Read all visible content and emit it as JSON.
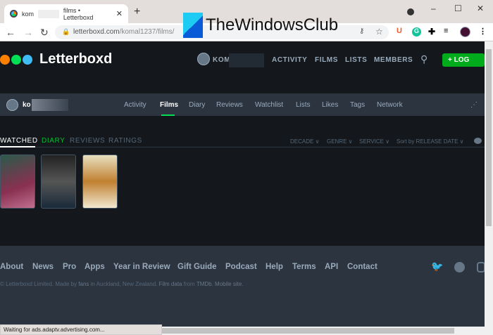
{
  "browser": {
    "tab_title_prefix": "kom",
    "tab_title_suffix": "films • Letterboxd",
    "new_tab": "+",
    "url_host": "letterboxd.com",
    "url_path": "/komal1237/films/",
    "watermark": "TheWindowsClub",
    "status": "Waiting for ads.adaptv.advertising.com..."
  },
  "header": {
    "brand": "Letterboxd",
    "user": "KOM",
    "nav": [
      "ACTIVITY",
      "FILMS",
      "LISTS",
      "MEMBERS"
    ],
    "log": "+ LOG",
    "colors": {
      "orange": "#ff8000",
      "green": "#00e054",
      "blue": "#40bcf4"
    }
  },
  "profile": {
    "user": "ko",
    "tabs": [
      "Activity",
      "Films",
      "Diary",
      "Reviews",
      "Watchlist",
      "Lists",
      "Likes",
      "Tags",
      "Network"
    ],
    "active": "Films"
  },
  "filters": {
    "views": [
      "WATCHED",
      "DIARY",
      "REVIEWS",
      "RATINGS"
    ],
    "right": [
      "DECADE ∨",
      "GENRE ∨",
      "SERVICE ∨",
      "Sort by RELEASE DATE ∨"
    ]
  },
  "footer": {
    "links": [
      "About",
      "News",
      "Pro",
      "Apps",
      "Year in Review",
      "Gift Guide",
      "Podcast",
      "Help",
      "Terms",
      "API",
      "Contact"
    ],
    "copy1": "© Letterboxd Limited. Made by ",
    "fans": "fans",
    "copy2": " in Auckland, New Zealand. ",
    "filmdata": "Film data",
    "copy3": " from ",
    "tmdb": "TMDb",
    "copy4": ". ",
    "mobile": "Mobile site",
    "copy5": "."
  }
}
